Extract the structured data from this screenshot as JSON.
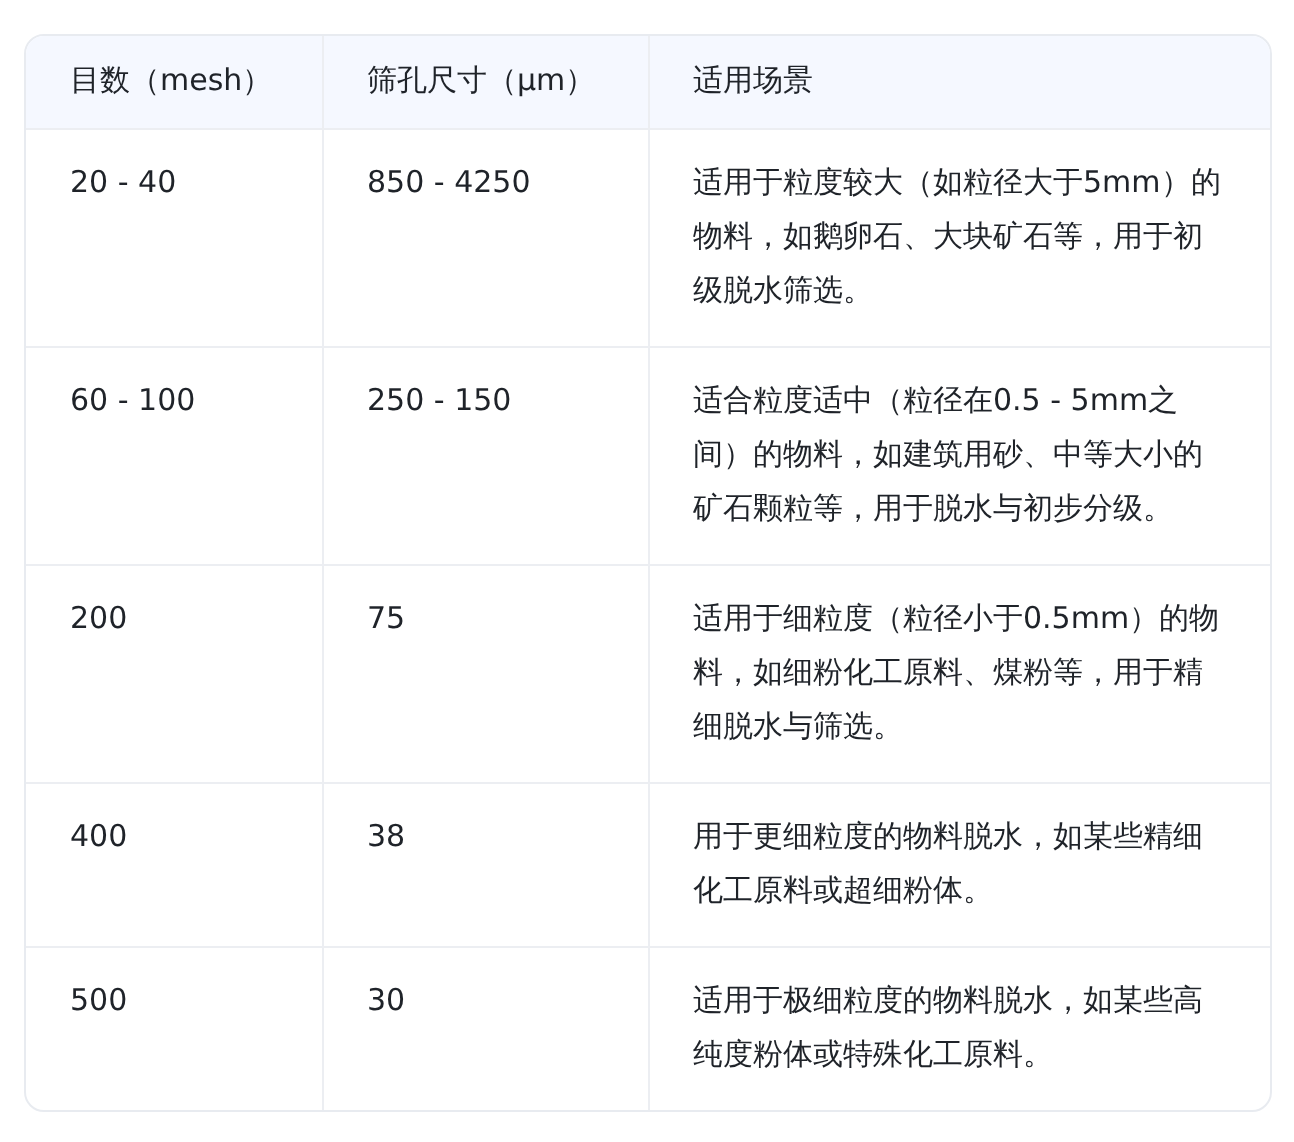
{
  "table": {
    "columns": [
      "目数（mesh）",
      "筛孔尺寸（μm）",
      "适用场景"
    ],
    "rows": [
      [
        "20 - 40",
        "850 - 4250",
        "适用于粒度较大（如粒径大于5mm）的物料，如鹅卵石、大块矿石等，用于初级脱水筛选。"
      ],
      [
        "60 - 100",
        "250 - 150",
        "适合粒度适中（粒径在0.5 - 5mm之间）的物料，如建筑用砂、中等大小的矿石颗粒等，用于脱水与初步分级。"
      ],
      [
        "200",
        "75",
        "适用于细粒度（粒径小于0.5mm）的物料，如细粉化工原料、煤粉等，用于精细脱水与筛选。"
      ],
      [
        "400",
        "38",
        "用于更细粒度的物料脱水，如某些精细化工原料或超细粉体。"
      ],
      [
        "500",
        "30",
        "适用于极细粒度的物料脱水，如某些高纯度粉体或特殊化工原料。"
      ]
    ]
  }
}
